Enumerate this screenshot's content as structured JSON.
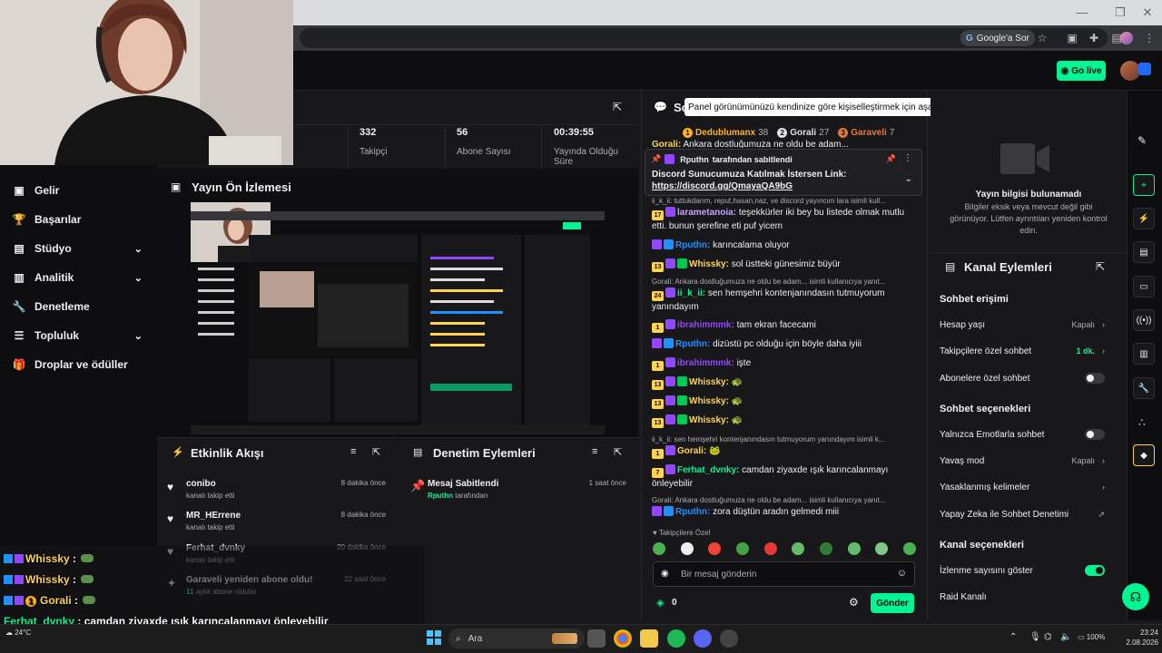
{
  "browser": {
    "google_sor": "Google'a Sor"
  },
  "topbar": {
    "go_live": "Go live"
  },
  "nav": {
    "items": [
      {
        "label": "Gelir",
        "icon": "revenue-icon",
        "chevron": false
      },
      {
        "label": "Başarılar",
        "icon": "trophy-icon",
        "chevron": false
      },
      {
        "label": "Stüdyo",
        "icon": "studio-icon",
        "chevron": true
      },
      {
        "label": "Analitik",
        "icon": "analytics-icon",
        "chevron": true
      },
      {
        "label": "Denetleme",
        "icon": "wrench-icon",
        "chevron": false
      },
      {
        "label": "Topluluk",
        "icon": "community-icon",
        "chevron": true
      },
      {
        "label": "Droplar ve ödüller",
        "icon": "gift-icon",
        "chevron": false
      }
    ]
  },
  "stats": {
    "followers": {
      "value": "332",
      "label": "Takipçi"
    },
    "subs": {
      "value": "56",
      "label": "Abone Sayısı"
    },
    "uptime": {
      "value": "00:39:55",
      "label": "Yayında Olduğu Süre"
    }
  },
  "preview": {
    "title": "Yayın Ön İzlemesi"
  },
  "activity": {
    "title": "Etkinlik Akışı",
    "items": [
      {
        "name": "conibo",
        "sub": "kanalı takip etti",
        "time": "8 dakika önce",
        "icon": "heart-icon"
      },
      {
        "name": "MR_HErrene",
        "sub": "kanalı takip etti",
        "time": "8 dakika önce",
        "icon": "heart-icon"
      },
      {
        "name": "Ferhat_dvnky",
        "sub": "kanalı takip etti",
        "time": "20 dakika önce",
        "icon": "heart-icon"
      },
      {
        "name": "Garaveli yeniden abone oldu!",
        "sub_num": "11",
        "sub": "aylık abone oldular",
        "time": "22 saat önce",
        "icon": "sparkle-icon"
      }
    ]
  },
  "modactions": {
    "title": "Denetim Eylemleri",
    "items": [
      {
        "name": "Mesaj Sabitlendi",
        "actor": "Rputhn",
        "sub": "tarafından",
        "time": "1 saat önce"
      }
    ]
  },
  "chat": {
    "title": "So",
    "tooltip": "Panel görünümünüzü kendinize göre kişiselleştirmek için aşağıdaki ekran araçlarına tıklayın veya sürükleyin",
    "leaderboard": [
      {
        "rank": "1",
        "name": "Dedublumanx",
        "points": "38"
      },
      {
        "rank": "2",
        "name": "Gorali",
        "points": "27"
      },
      {
        "rank": "3",
        "name": "Garaveli",
        "points": "7"
      }
    ],
    "partial_line": {
      "name": "Gorali:",
      "text": "Ankara dostluğumuza ne oldu be adam..."
    },
    "pinned": {
      "by": "Rputhn",
      "by_suffix": "tarafından sabitlendi",
      "text": "Discord Sunucumuza Katılmak İstersen Link:",
      "link": "https://discord.gg/QmayaQA9bG"
    },
    "sys1": "ii_k_ii: tuttukdarım, reput,hasan,naz, ve discord yayıncım lara isimli kull...",
    "messages": [
      {
        "badge": "17",
        "name": "larametanoia:",
        "text": "teşekkürler iki bey bu listede olmak mutlu etti. bunun şerefine eti puf yicem",
        "color": "#c6a1ff",
        "lines": 2
      },
      {
        "badge": "",
        "name": "Rputhn:",
        "text": "karıncalama oluyor",
        "color": "#1e90ff",
        "lines": 1
      },
      {
        "badge": "13",
        "name": "Whissky:",
        "text": "sol üstteki günesimiz büyür",
        "color": "#ffd34d",
        "lines": 1
      }
    ],
    "sys2": "Gorali: Ankara dostluğumuza ne oldu be adam... isimli kullanıcıya yanıt...",
    "messages2": [
      {
        "badge": "24",
        "name": "ii_k_ii:",
        "text": "sen hemşehri kontenjanındasın tutmuyorum yanındayım",
        "color": "#00f593",
        "lines": 2
      },
      {
        "badge": "1",
        "name": "ibrahimmmk:",
        "text": "tam ekran facecami",
        "color": "#9147ff",
        "lines": 1
      },
      {
        "badge": "",
        "name": "Rputhn:",
        "text": "dizüstü pc olduğu için böyle daha iyiii",
        "color": "#1e90ff",
        "lines": 1
      },
      {
        "badge": "1",
        "name": "ibrahimmmk:",
        "text": "işte",
        "color": "#9147ff",
        "lines": 1
      },
      {
        "badge": "13",
        "name": "Whissky:",
        "text": "🐢",
        "color": "#ffd34d",
        "lines": 1
      },
      {
        "badge": "13",
        "name": "Whissky:",
        "text": "🐢",
        "color": "#ffd34d",
        "lines": 1
      },
      {
        "badge": "13",
        "name": "Whissky:",
        "text": "🐢",
        "color": "#ffd34d",
        "lines": 1
      }
    ],
    "sys3": "ii_k_ii: sen hemşehri kontenjanındasın tutmuyorum yanındayım isimli k...",
    "messages3": [
      {
        "badge": "1",
        "name": "Gorali:",
        "text": "🐸",
        "color": "#ffd34d",
        "lines": 1
      },
      {
        "badge": "7",
        "name": "Ferhat_dvnky:",
        "text": "camdan ziyaxde ışık karıncalanmayı önleyebilir",
        "color": "#00f593",
        "lines": 2
      }
    ],
    "sys4": "Gorali: Ankara dostluğumuza ne oldu be adam... isimli kullanıcıya yanıt...",
    "messages4": [
      {
        "badge": "",
        "name": "Rputhn:",
        "text": "zora düştün aradın gelmedi miii",
        "color": "#1e90ff",
        "lines": 1
      }
    ],
    "followers_only": "Takipçilere Özel",
    "input_placeholder": "Bir mesaj gönderin",
    "points": "0",
    "send": "Gönder"
  },
  "streaminfo": {
    "title": "Yayın bilgisi bulunamadı",
    "body": "Bilgiler eksik veya mevcut değil gibi görünüyor. Lütfen ayrıntıları yeniden kontrol edin."
  },
  "channelactions": {
    "title": "Kanal Eylemleri",
    "section1": "Sohbet erişimi",
    "account_age": {
      "label": "Hesap yaşı",
      "value": "Kapalı"
    },
    "follower_only": {
      "label": "Takipçilere özel sohbet",
      "value": "1 dk."
    },
    "sub_only": {
      "label": "Abonelere özel sohbet"
    },
    "section2": "Sohbet seçenekleri",
    "emote_only": {
      "label": "Yalnızca Emotlarla sohbet"
    },
    "slow_mode": {
      "label": "Yavaş mod",
      "value": "Kapalı"
    },
    "banned_words": {
      "label": "Yasaklanmış kelimeler"
    },
    "ai_mod": {
      "label": "Yapay Zeka ile Sohbet Denetimi"
    },
    "section3": "Kanal seçenekleri",
    "viewer_count": {
      "label": "İzlenme sayısını göster"
    },
    "raid": {
      "label": "Raid Kanalı"
    }
  },
  "overlay_chat": [
    {
      "name": "Whissky",
      "text": ":",
      "color": "#ffd34d"
    },
    {
      "name": "Whissky",
      "text": ":",
      "color": "#ffd34d"
    },
    {
      "name": "Gorali",
      "text": ":",
      "color": "#ffd34d"
    },
    {
      "name": "Ferhat_dvnky",
      "text": ": camdan ziyaxde ışık karıncalanmayı önleyebilir",
      "color": "#00f593"
    },
    {
      "name": "Rputhn",
      "text": ": zora düştün aradın gelmedi miii",
      "color": "#1e90ff"
    }
  ],
  "overlay_badges": [
    "1"
  ],
  "taskbar": {
    "search": "Ara",
    "temp": "24°C",
    "battery": "100%",
    "time": "23:24",
    "date": "2.08.2026"
  },
  "colors": {
    "accent_green": "#00f593",
    "twitch_purple": "#9147ff"
  }
}
